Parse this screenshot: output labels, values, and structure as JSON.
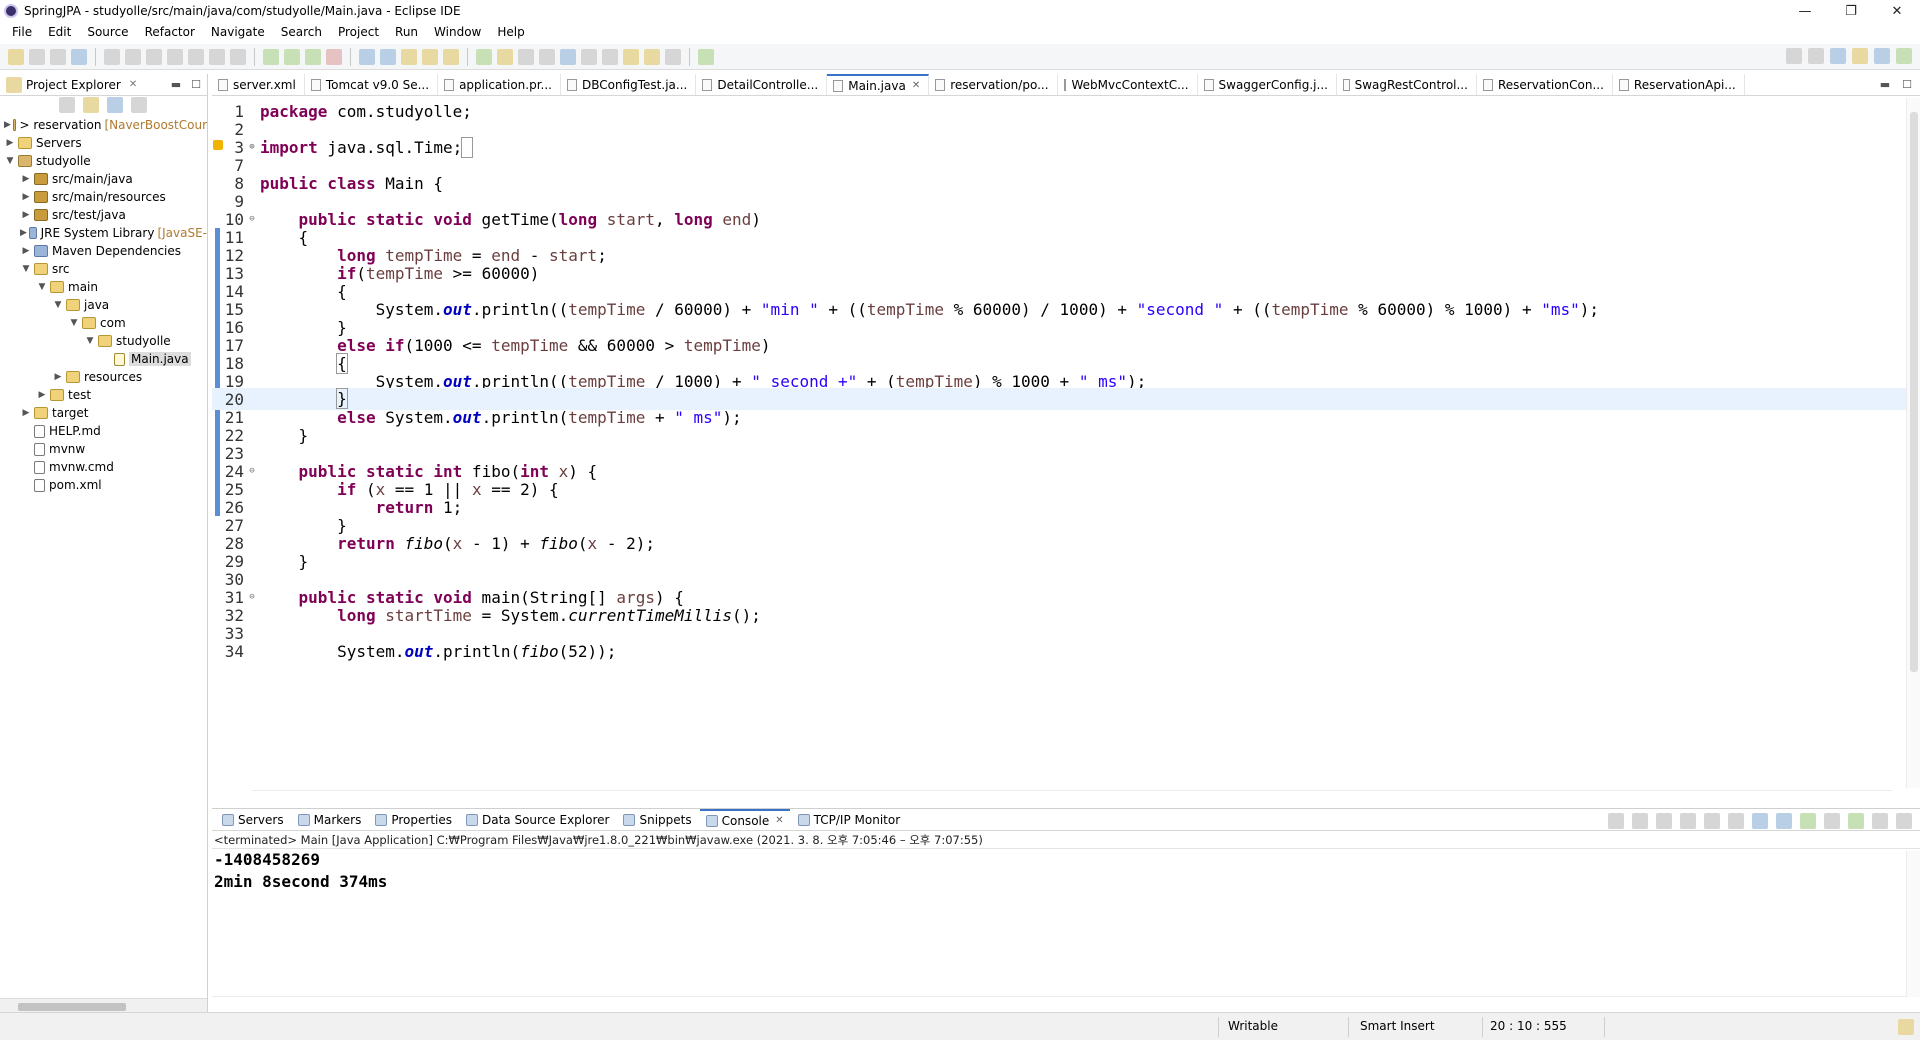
{
  "window": {
    "title": "SpringJPA - studyolle/src/main/java/com/studyolle/Main.java - Eclipse IDE",
    "controls": [
      "—",
      "❐",
      "✕"
    ]
  },
  "menu": [
    "File",
    "Edit",
    "Source",
    "Refactor",
    "Navigate",
    "Search",
    "Project",
    "Run",
    "Window",
    "Help"
  ],
  "project_explorer": {
    "title": "Project Explorer",
    "close": "✕",
    "tree": [
      {
        "depth": 0,
        "twisty": "▶",
        "icon": "proj",
        "label": ">  reservation",
        "suffix": "[NaverBoostCour"
      },
      {
        "depth": 0,
        "twisty": "▶",
        "icon": "folder",
        "label": "Servers",
        "suffix": ""
      },
      {
        "depth": 0,
        "twisty": "▼",
        "icon": "proj",
        "label": "studyolle",
        "suffix": ""
      },
      {
        "depth": 1,
        "twisty": "▶",
        "icon": "pkgfolder",
        "label": "src/main/java",
        "suffix": ""
      },
      {
        "depth": 1,
        "twisty": "▶",
        "icon": "pkgfolder",
        "label": "src/main/resources",
        "suffix": ""
      },
      {
        "depth": 1,
        "twisty": "▶",
        "icon": "pkgfolder",
        "label": "src/test/java",
        "suffix": ""
      },
      {
        "depth": 1,
        "twisty": "▶",
        "icon": "lib",
        "label": "JRE System Library",
        "suffix": "[JavaSE-"
      },
      {
        "depth": 1,
        "twisty": "▶",
        "icon": "lib",
        "label": "Maven Dependencies",
        "suffix": ""
      },
      {
        "depth": 1,
        "twisty": "▼",
        "icon": "folder",
        "label": "src",
        "suffix": ""
      },
      {
        "depth": 2,
        "twisty": "▼",
        "icon": "folder",
        "label": "main",
        "suffix": ""
      },
      {
        "depth": 3,
        "twisty": "▼",
        "icon": "folder",
        "label": "java",
        "suffix": ""
      },
      {
        "depth": 4,
        "twisty": "▼",
        "icon": "folder",
        "label": "com",
        "suffix": ""
      },
      {
        "depth": 5,
        "twisty": "▼",
        "icon": "folder",
        "label": "studyolle",
        "suffix": ""
      },
      {
        "depth": 6,
        "twisty": "",
        "icon": "java",
        "label": "Main.java",
        "suffix": "",
        "selected": true
      },
      {
        "depth": 3,
        "twisty": "▶",
        "icon": "folder",
        "label": "resources",
        "suffix": ""
      },
      {
        "depth": 2,
        "twisty": "▶",
        "icon": "folder",
        "label": "test",
        "suffix": ""
      },
      {
        "depth": 1,
        "twisty": "▶",
        "icon": "folder",
        "label": "target",
        "suffix": ""
      },
      {
        "depth": 1,
        "twisty": "",
        "icon": "file",
        "label": "HELP.md",
        "suffix": ""
      },
      {
        "depth": 1,
        "twisty": "",
        "icon": "file",
        "label": "mvnw",
        "suffix": ""
      },
      {
        "depth": 1,
        "twisty": "",
        "icon": "file",
        "label": "mvnw.cmd",
        "suffix": ""
      },
      {
        "depth": 1,
        "twisty": "",
        "icon": "file",
        "label": "pom.xml",
        "suffix": ""
      }
    ]
  },
  "editor": {
    "tabs": [
      {
        "label": "server.xml",
        "active": false
      },
      {
        "label": "Tomcat v9.0 Se...",
        "active": false
      },
      {
        "label": "application.pr...",
        "active": false
      },
      {
        "label": "DBConfigTest.ja...",
        "active": false
      },
      {
        "label": "DetailControlle...",
        "active": false
      },
      {
        "label": "Main.java",
        "active": true
      },
      {
        "label": "reservation/po...",
        "active": false
      },
      {
        "label": "WebMvcContextC...",
        "active": false
      },
      {
        "label": "SwaggerConfig.j...",
        "active": false
      },
      {
        "label": "SwagRestControl...",
        "active": false
      },
      {
        "label": "ReservationCon...",
        "active": false
      },
      {
        "label": "ReservationApi...",
        "active": false
      }
    ],
    "tab_close": "✕",
    "current_line": 20,
    "lines": [
      {
        "n": "1",
        "fold": "",
        "html": "<span class='kw'>package</span> com.studyolle;"
      },
      {
        "n": "2",
        "fold": "",
        "html": ""
      },
      {
        "n": "3",
        "fold": "⊕",
        "html": "<span class='kw'>import</span> java.sql.Time;<span class='bracket'>&nbsp;</span>"
      },
      {
        "n": "7",
        "fold": "",
        "html": ""
      },
      {
        "n": "8",
        "fold": "",
        "html": "<span class='kw'>public class</span> Main {"
      },
      {
        "n": "9",
        "fold": "",
        "html": ""
      },
      {
        "n": "10",
        "fold": "⊖",
        "html": "    <span class='kw'>public static void</span> getTime(<span class='kw'>long</span> <span class='var'>start</span>, <span class='kw'>long</span> <span class='var'>end</span>)"
      },
      {
        "n": "11",
        "fold": "",
        "html": "    {"
      },
      {
        "n": "12",
        "fold": "",
        "html": "        <span class='kw'>long</span> <span class='var'>tempTime</span> = <span class='var'>end</span> - <span class='var'>start</span>;"
      },
      {
        "n": "13",
        "fold": "",
        "html": "        <span class='kw'>if</span>(<span class='var'>tempTime</span> >= 60000)"
      },
      {
        "n": "14",
        "fold": "",
        "html": "        {"
      },
      {
        "n": "15",
        "fold": "",
        "html": "            System.<span class='st'>out</span>.println((<span class='var'>tempTime</span> / 60000) + <span class='str'>\"min \"</span> + ((<span class='var'>tempTime</span> % 60000) / 1000) + <span class='str'>\"second \"</span> + ((<span class='var'>tempTime</span> % 60000) % 1000) + <span class='str'>\"ms\"</span>);"
      },
      {
        "n": "16",
        "fold": "",
        "html": "        }"
      },
      {
        "n": "17",
        "fold": "",
        "html": "        <span class='kw'>else if</span>(1000 <= <span class='var'>tempTime</span> && 60000 > <span class='var'>tempTime</span>)"
      },
      {
        "n": "18",
        "fold": "",
        "html": "        <span class='bracket'>{</span>"
      },
      {
        "n": "19",
        "fold": "",
        "html": "            System.<span class='st'>out</span>.println((<span class='var'>tempTime</span> / 1000) + <span class='str'>\" second +\"</span> + (<span class='var'>tempTime</span>) % 1000 + <span class='str'>\" ms\"</span>);"
      },
      {
        "n": "20",
        "fold": "",
        "html": "        <span class='bracket'>}</span><span class='caret'></span>"
      },
      {
        "n": "21",
        "fold": "",
        "html": "        <span class='kw'>else</span> System.<span class='st'>out</span>.println(<span class='var'>tempTime</span> + <span class='str'>\" ms\"</span>);"
      },
      {
        "n": "22",
        "fold": "",
        "html": "    }"
      },
      {
        "n": "23",
        "fold": "",
        "html": ""
      },
      {
        "n": "24",
        "fold": "⊖",
        "html": "    <span class='kw'>public static int</span> fibo(<span class='kw'>int</span> <span class='var'>x</span>) {"
      },
      {
        "n": "25",
        "fold": "",
        "html": "        <span class='kw'>if</span> (<span class='var'>x</span> == 1 || <span class='var'>x</span> == 2) {"
      },
      {
        "n": "26",
        "fold": "",
        "html": "            <span class='kw'>return</span> 1;"
      },
      {
        "n": "27",
        "fold": "",
        "html": "        }"
      },
      {
        "n": "28",
        "fold": "",
        "html": "        <span class='kw'>return</span> <span class='ital'>fibo</span>(<span class='var'>x</span> - 1) + <span class='ital'>fibo</span>(<span class='var'>x</span> - 2);"
      },
      {
        "n": "29",
        "fold": "",
        "html": "    }"
      },
      {
        "n": "30",
        "fold": "",
        "html": ""
      },
      {
        "n": "31",
        "fold": "⊖",
        "html": "    <span class='kw'>public static void</span> main(String[] <span class='var'>args</span>) {"
      },
      {
        "n": "32",
        "fold": "",
        "html": "        <span class='kw'>long</span> <span class='var'>startTime</span> = System.<span class='ital'>currentTimeMillis</span>();"
      },
      {
        "n": "33",
        "fold": "",
        "html": ""
      },
      {
        "n": "34",
        "fold": "",
        "html": "        System.<span class='st'>out</span>.println(<span class='ital'>fibo</span>(52));"
      }
    ]
  },
  "console": {
    "tabs": [
      {
        "label": "Servers",
        "active": false
      },
      {
        "label": "Markers",
        "active": false
      },
      {
        "label": "Properties",
        "active": false
      },
      {
        "label": "Data Source Explorer",
        "active": false
      },
      {
        "label": "Snippets",
        "active": false
      },
      {
        "label": "Console",
        "active": true
      },
      {
        "label": "TCP/IP Monitor",
        "active": false
      }
    ],
    "close": "✕",
    "info": "<terminated> Main [Java Application] C:₩Program Files₩Java₩jre1.8.0_221₩bin₩javaw.exe  (2021. 3. 8. 오후 7:05:46 – 오후 7:07:55)",
    "output": [
      "-1408458269",
      "2min 8second 374ms"
    ]
  },
  "status": {
    "mode": "Writable",
    "insert": "Smart Insert",
    "position": "20 : 10 : 555"
  }
}
